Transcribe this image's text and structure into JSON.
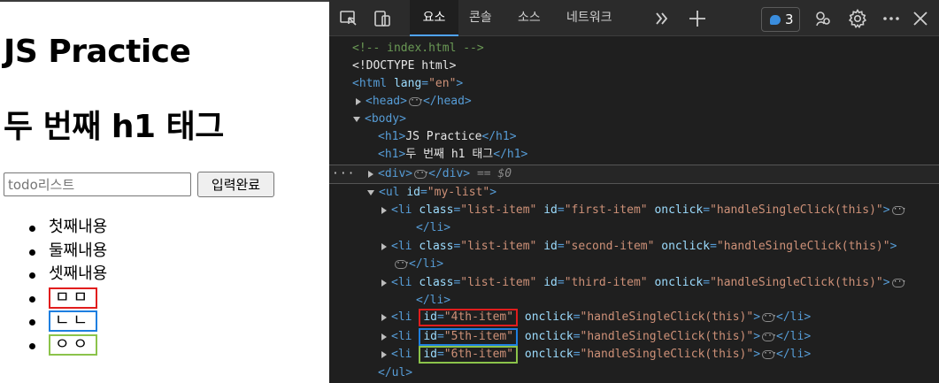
{
  "page": {
    "heading1": "JS Practice",
    "heading2": "두 번째 h1 태그",
    "input_placeholder": "todo리스트",
    "submit_label": "입력완료",
    "list_items": [
      "첫째내용",
      "둘째내용",
      "셋째내용"
    ],
    "boxed_items": [
      {
        "text": "ㅁㅁ",
        "color": "#e11d1d"
      },
      {
        "text": "ㄴㄴ",
        "color": "#1e7fe0"
      },
      {
        "text": "ㅇㅇ",
        "color": "#8bc34a"
      }
    ]
  },
  "devtools": {
    "tabs": {
      "elements": "요소",
      "console": "콘솔",
      "sources": "소스",
      "network": "네트워크"
    },
    "issues_count": "3",
    "colors": {
      "selected_tab_underline": "#4fa3ff",
      "tag": "#569cd6",
      "attribute": "#9cdcfe",
      "value": "#ce9178",
      "comment": "#6a9955"
    },
    "tree": {
      "comment": "<!-- index.html -->",
      "doctype": "<!DOCTYPE html>",
      "html_open": "<html ",
      "html_attr": "lang",
      "html_val": "\"en\"",
      "html_close": ">",
      "head_open": "<head>",
      "head_close": "</head>",
      "body_open": "<body>",
      "h1_open": "<h1>",
      "h1_close": "</h1>",
      "h1_text_1": "JS Practice",
      "h1_text_2": "두 번째 h1 태그",
      "div_open": "<div>",
      "div_close": "</div>",
      "selected_hint": "== $0",
      "ul_open": "<ul ",
      "ul_attr": "id",
      "ul_val": "\"my-list\"",
      "ul_end": ">",
      "ul_close": "</ul>",
      "li_open": "<li ",
      "li_close": "</li>",
      "gt": ">",
      "class_attr": "class",
      "id_attr": "id",
      "onclick_attr": "onclick",
      "class_val": "\"list-item\"",
      "onclick_val": "\"handleSingleClick(this)\"",
      "id_first": "\"first-item\"",
      "id_second": "\"second-item\"",
      "id_third": "\"third-item\"",
      "id_4th": "\"4th-item\"",
      "id_5th": "\"5th-item\"",
      "id_6th": "\"6th-item\"",
      "eq": "=",
      "gutter_dots": "···"
    }
  }
}
